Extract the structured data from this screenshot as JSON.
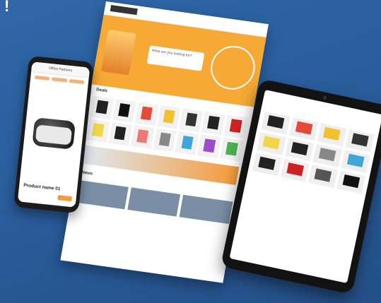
{
  "decor": {
    "mark": "!"
  },
  "web": {
    "search_placeholder": "What are you looking for?",
    "section_title": "Deals",
    "news_title": "News"
  },
  "phone": {
    "header": "Office Partners",
    "product_name": "Product name 01"
  },
  "colors": {
    "background": "#2b5f9e",
    "accent": "#f6a934"
  }
}
